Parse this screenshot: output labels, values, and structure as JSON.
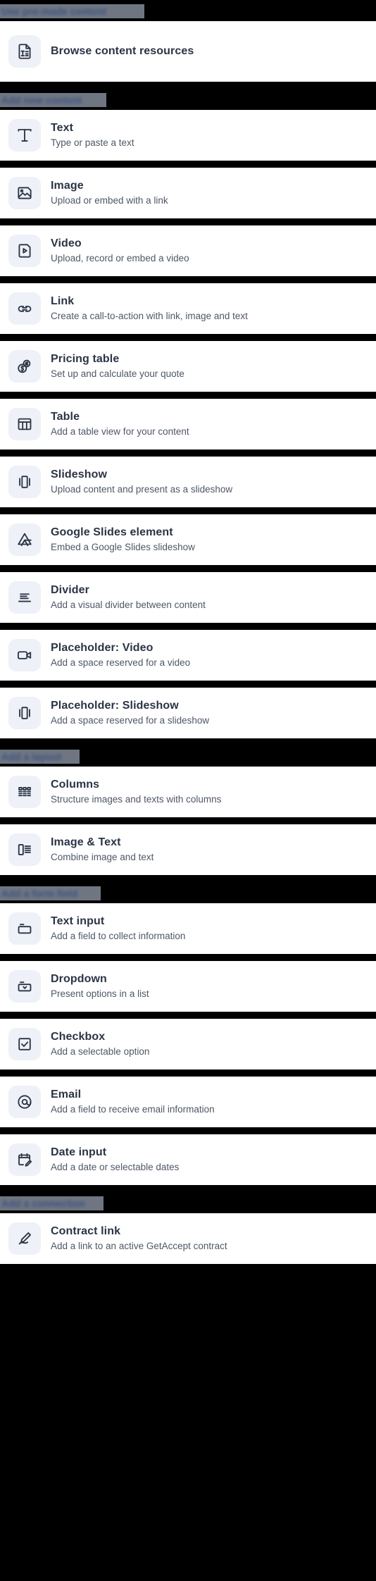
{
  "panel": {
    "name": "content-block-picker"
  },
  "sections": [
    {
      "heading": "Use pre-made content",
      "heading_obscured": true,
      "heading_width": 205,
      "items": [
        {
          "icon": "document-text-icon",
          "title": "Browse content resources",
          "subtitle": ""
        }
      ]
    },
    {
      "heading": "Add new content",
      "heading_obscured": true,
      "heading_width": 151,
      "items": [
        {
          "icon": "text-icon",
          "title": "Text",
          "subtitle": "Type or paste a text"
        },
        {
          "icon": "image-icon",
          "title": "Image",
          "subtitle": "Upload or embed with a link"
        },
        {
          "icon": "video-file-icon",
          "title": "Video",
          "subtitle": "Upload, record or embed a video"
        },
        {
          "icon": "link-icon",
          "title": "Link",
          "subtitle": "Create a call-to-action with link, image and text"
        },
        {
          "icon": "coins-currency-icon",
          "title": "Pricing table",
          "subtitle": "Set up and calculate your quote"
        },
        {
          "icon": "table-icon",
          "title": "Table",
          "subtitle": "Add a table view for your content"
        },
        {
          "icon": "slideshow-icon",
          "title": "Slideshow",
          "subtitle": "Upload content and present as a slideshow"
        },
        {
          "icon": "google-drive-icon",
          "title": "Google Slides element",
          "subtitle": "Embed a Google Slides slideshow"
        },
        {
          "icon": "divider-icon",
          "title": "Divider",
          "subtitle": "Add a visual divider between content"
        },
        {
          "icon": "video-camera-icon",
          "title": "Placeholder: Video",
          "subtitle": "Add a space reserved for a video"
        },
        {
          "icon": "slideshow-icon",
          "title": "Placeholder: Slideshow",
          "subtitle": "Add a space reserved for a slideshow"
        }
      ]
    },
    {
      "heading": "Add a layout",
      "heading_obscured": true,
      "heading_width": 113,
      "items": [
        {
          "icon": "columns-icon",
          "title": "Columns",
          "subtitle": "Structure images and texts with columns"
        },
        {
          "icon": "image-and-text-icon",
          "title": "Image & Text",
          "subtitle": "Combine image and text"
        }
      ]
    },
    {
      "heading": "Add a form field",
      "heading_obscured": true,
      "heading_width": 143,
      "items": [
        {
          "icon": "text-input-icon",
          "title": "Text input",
          "subtitle": "Add a field to collect information"
        },
        {
          "icon": "dropdown-icon",
          "title": "Dropdown",
          "subtitle": "Present options in a list"
        },
        {
          "icon": "checkbox-icon",
          "title": "Checkbox",
          "subtitle": "Add a selectable option"
        },
        {
          "icon": "at-sign-icon",
          "title": "Email",
          "subtitle": "Add a field to receive email information"
        },
        {
          "icon": "calendar-edit-icon",
          "title": "Date input",
          "subtitle": "Add a date or selectable dates"
        }
      ]
    },
    {
      "heading": "Add a connection",
      "heading_obscured": true,
      "heading_width": 147,
      "items": [
        {
          "icon": "signature-pen-icon",
          "title": "Contract link",
          "subtitle": "Add a link to an active GetAccept contract"
        }
      ]
    }
  ],
  "colors": {
    "background": "#000000",
    "card": "#ffffff",
    "tile": "#eef1f7",
    "title": "#2b3445",
    "subtitle": "#4e5766",
    "redaction": "#6f7682",
    "redaction_text": "#3a5080"
  }
}
